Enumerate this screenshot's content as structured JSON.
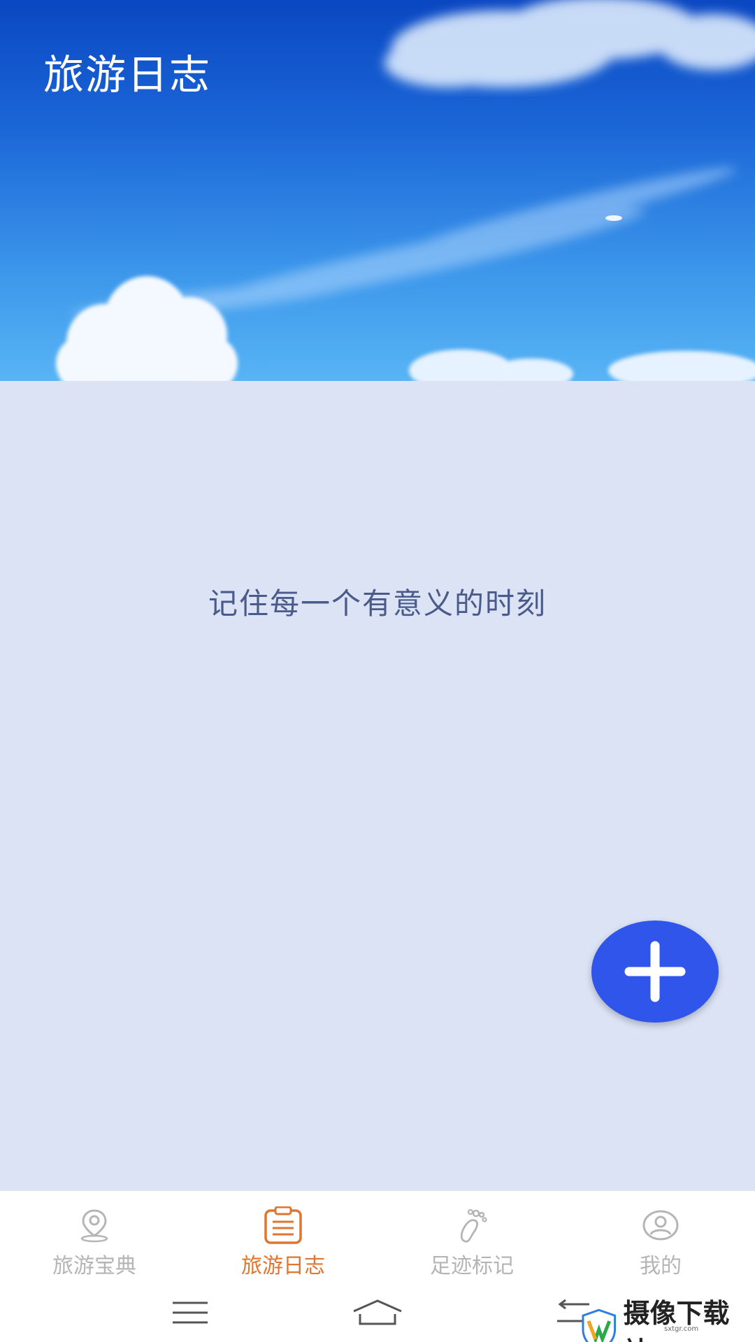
{
  "header": {
    "title": "旅游日志"
  },
  "main": {
    "empty_text": "记住每一个有意义的时刻"
  },
  "fab": {
    "icon": "plus-icon"
  },
  "bottom_nav": {
    "items": [
      {
        "label": "旅游宝典",
        "icon": "location-pin-icon",
        "active": false
      },
      {
        "label": "旅游日志",
        "icon": "clipboard-icon",
        "active": true
      },
      {
        "label": "足迹标记",
        "icon": "footprint-icon",
        "active": false
      },
      {
        "label": "我的",
        "icon": "profile-icon",
        "active": false
      }
    ]
  },
  "system_nav": {
    "menu_icon": "menu-icon",
    "home_icon": "home-icon",
    "back_icon": "back-icon"
  },
  "watermark": {
    "text": "摄像下载站",
    "sub": "sxtgr.com"
  },
  "colors": {
    "accent_active": "#e0752f",
    "inactive": "#b5b5b5",
    "fab": "#2f55ea",
    "background": "#dbe3f5"
  }
}
